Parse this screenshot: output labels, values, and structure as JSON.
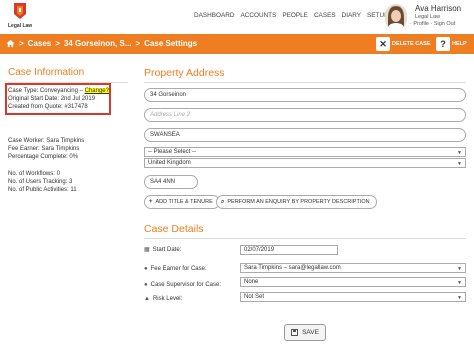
{
  "header": {
    "logo_text": "Legal Law",
    "nav": [
      "DASHBOARD",
      "ACCOUNTS",
      "PEOPLE",
      "CASES",
      "DIARY",
      "SETUP"
    ],
    "user_name": "Ava Harrison",
    "user_org": "Legal Law",
    "user_links": "· Profile · Sign Out"
  },
  "toolbar": {
    "breadcrumbs": [
      "Cases",
      "34 Gorseinon, S...",
      "Case Settings"
    ],
    "separator": ">",
    "delete_label": "DELETE CASE",
    "help_label": "HELP",
    "help_glyph": "?"
  },
  "case_info": {
    "title": "Case Information",
    "case_type_label": "Case Type: Conveyancing",
    "case_type_dash": "–",
    "change_link": "Change?",
    "original_start": "Original Start Date: 2nd Jul 2019",
    "created_from": "Created from Quote: #317478",
    "case_worker": "Case Worker: Sara Timpkins",
    "fee_earner": "Fee Earner: Sara Timpkins",
    "percentage": "Percentage Complete: 0%",
    "workflows": "No. of Workflows: 0",
    "users_tracking": "No. of Users Tracking: 3",
    "public_activities": "No. of Public Activities: 11"
  },
  "property_address": {
    "title": "Property Address",
    "line1": "34 Gorseinon",
    "line2_placeholder": "Address Line 2",
    "town": "SWANSEA",
    "county": "-- Please Select --",
    "country": "United Kingdom",
    "postcode": "SA4 4NN",
    "add_title_button": "ADD TITLE & TENURE",
    "enquiry_button": "PERFORM AN ENQUIRY BY PROPERTY DESCRIPTION"
  },
  "case_details": {
    "title": "Case Details",
    "start_date_label": "Start Date:",
    "start_date_value": "02/07/2019",
    "fee_earner_label": "Fee Earner for Case:",
    "fee_earner_value": "Sara Timpkins  –  sara@legallaw.com",
    "supervisor_label": "Case Supervisor for Case:",
    "supervisor_value": "None",
    "risk_label": "Risk Level:",
    "risk_value": "Not Set",
    "save_label": "SAVE"
  },
  "colors": {
    "accent": "#ef7d21",
    "highlight_border": "#d63a2b",
    "highlight_fill": "#ffff00"
  }
}
